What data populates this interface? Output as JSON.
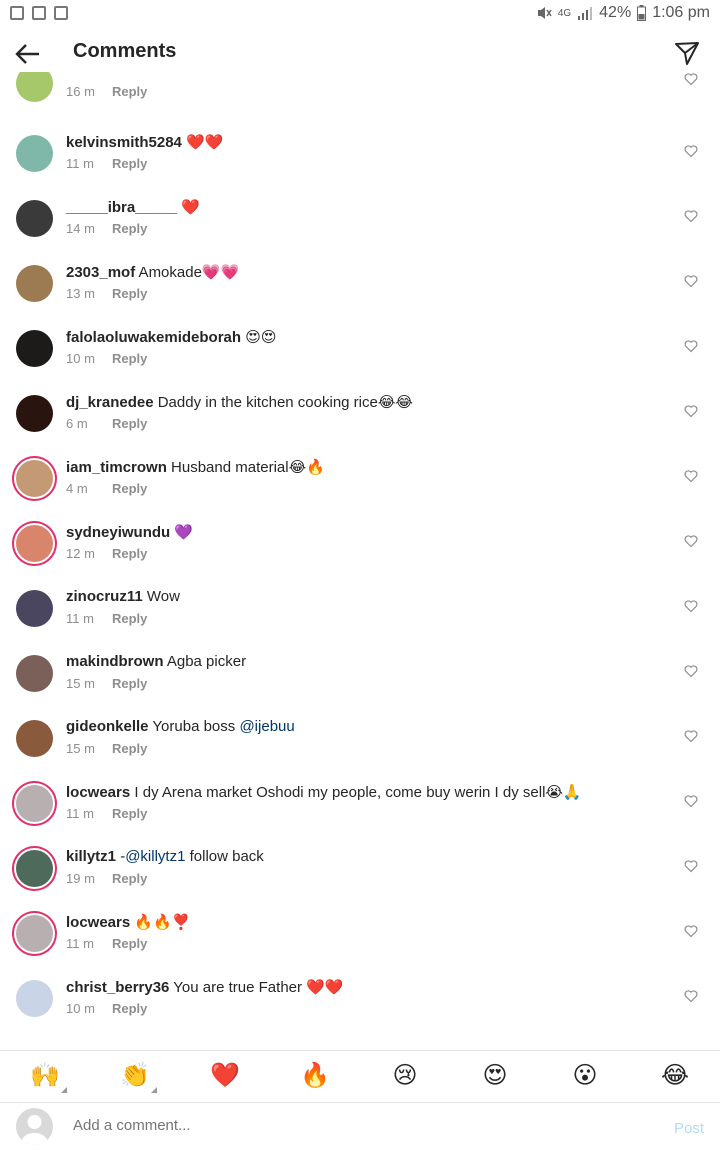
{
  "status_bar": {
    "battery": "42%",
    "time": "1:06 pm",
    "network": "4G"
  },
  "header": {
    "title": "Comments",
    "back_icon": "arrow-left-icon",
    "share_icon": "paper-plane-icon"
  },
  "comments": [
    {
      "user": "",
      "text": "",
      "time": "16 m",
      "reply": "Reply"
    },
    {
      "user": "kelvinsmith5284",
      "text": " ❤️❤️",
      "time": "11 m",
      "reply": "Reply"
    },
    {
      "user": "_____ibra_____",
      "text": " ❤️",
      "time": "14 m",
      "reply": "Reply"
    },
    {
      "user": "2303_mof",
      "text": " Amokade💗💗",
      "time": "13 m",
      "reply": "Reply"
    },
    {
      "user": "falolaoluwakemideborah",
      "text": " 😍😍",
      "time": "10 m",
      "reply": "Reply"
    },
    {
      "user": "dj_kranedee",
      "text": " Daddy in the kitchen cooking rice😂😂",
      "time": "6 m",
      "reply": "Reply"
    },
    {
      "user": "iam_timcrown",
      "text": " Husband material😂🔥",
      "time": "4 m",
      "reply": "Reply"
    },
    {
      "user": "sydneyiwundu",
      "text": " 💜",
      "time": "12 m",
      "reply": "Reply"
    },
    {
      "user": "zinocruz11",
      "text": " Wow",
      "time": "11 m",
      "reply": "Reply"
    },
    {
      "user": "makindbrown",
      "text": " Agba picker",
      "time": "15 m",
      "reply": "Reply"
    },
    {
      "user": "gideonkelle",
      "text": " Yoruba boss ",
      "mention": "@ijebuu",
      "time": "15 m",
      "reply": "Reply"
    },
    {
      "user": "locwears",
      "text": " I dy Arena market  Oshodi my people, come buy werin I dy sell😭🙏",
      "time": "11 m",
      "reply": "Reply"
    },
    {
      "user": "killytz1",
      "text": " -",
      "mention": "@killytz1",
      "text_after": " follow back",
      "time": "19 m",
      "reply": "Reply"
    },
    {
      "user": "locwears",
      "text": " 🔥🔥❣️",
      "time": "11 m",
      "reply": "Reply"
    },
    {
      "user": "christ_berry36",
      "text": " You are true Father ❤️❤️",
      "time": "10 m",
      "reply": "Reply"
    }
  ],
  "emoji_bar": [
    "🙌",
    "👏",
    "❤️",
    "🔥",
    "😢",
    "😍",
    "😮",
    "😂"
  ],
  "composer": {
    "placeholder": "Add a comment...",
    "post_label": "Post"
  },
  "colors": {
    "accent_ring": "#e1306c",
    "post_disabled": "#b3dbff",
    "mention": "#00376b"
  }
}
